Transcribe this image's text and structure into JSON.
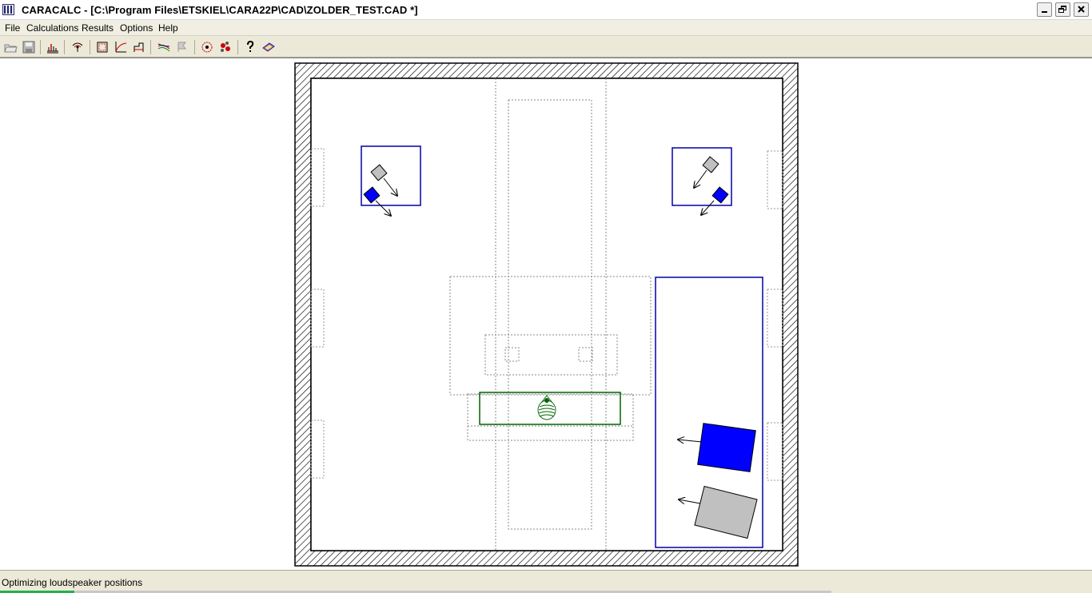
{
  "window": {
    "app_name": "CARACALC",
    "title": "CARACALC - [C:\\Program Files\\ETSKIEL\\CARA22P\\CAD\\ZOLDER_TEST.CAD *]"
  },
  "menu": {
    "items": [
      "File",
      "Calculations",
      "Results",
      "Options",
      "Help"
    ]
  },
  "toolbar": {
    "buttons": [
      {
        "icon": "open-folder-icon"
      },
      {
        "icon": "save-disk-icon"
      },
      {
        "icon": "impulse-response-icon"
      },
      {
        "icon": "loudspeaker-icon"
      },
      {
        "icon": "room-outline-icon"
      },
      {
        "icon": "frequency-curve-icon"
      },
      {
        "icon": "decay-step-icon"
      },
      {
        "icon": "response-curves-icon"
      },
      {
        "icon": "curve-marker-icon"
      },
      {
        "icon": "reverb-cloud-icon"
      },
      {
        "icon": "sound-distribution-icon"
      },
      {
        "icon": "help-question-icon"
      },
      {
        "icon": "manual-book-icon"
      }
    ]
  },
  "colors": {
    "speaker_blue": "#0000ff",
    "speaker_gray": "#c0c0c0",
    "listener_green": "#006400",
    "frame_blue": "#0000aa"
  },
  "status": {
    "text": "Optimizing loudspeaker positions",
    "progress_percent": 7
  }
}
